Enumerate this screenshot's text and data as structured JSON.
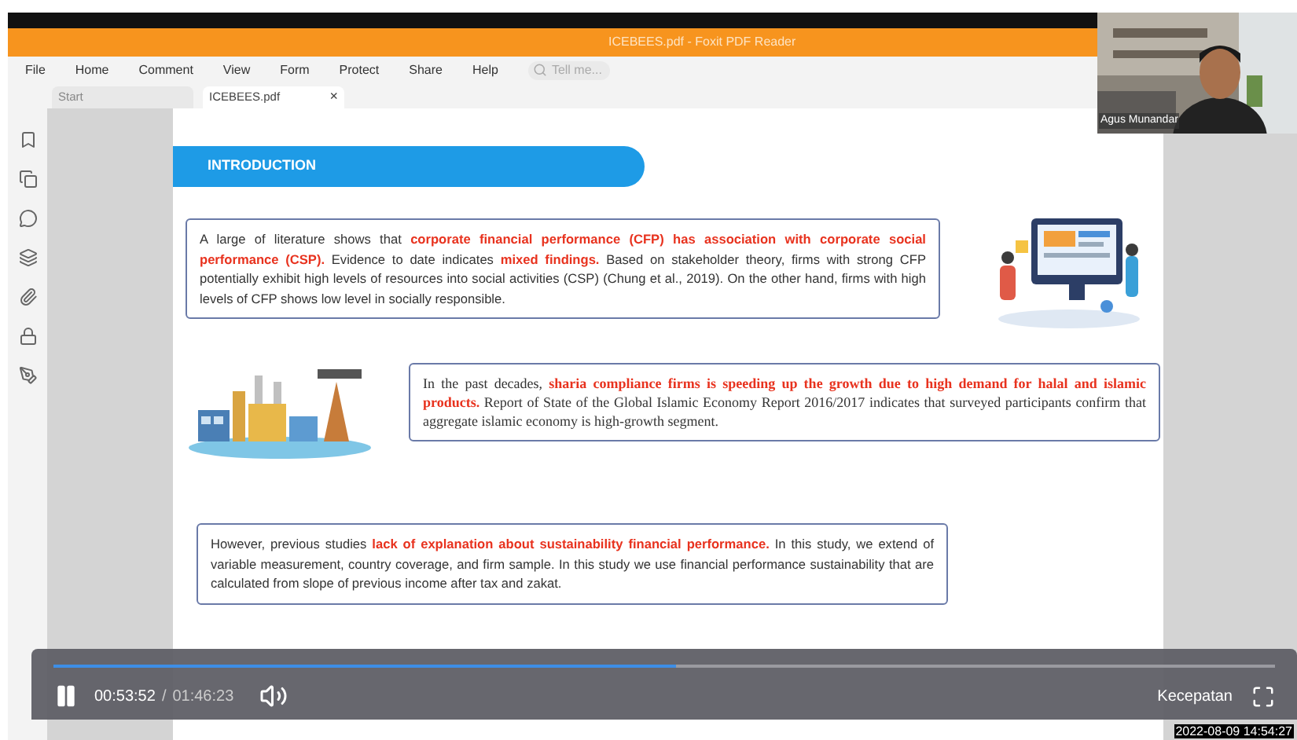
{
  "app": {
    "title": "ICEBEES.pdf - Foxit PDF Reader",
    "menu": [
      "File",
      "Home",
      "Comment",
      "View",
      "Form",
      "Protect",
      "Share",
      "Help"
    ],
    "search": {
      "placeholder": "Tell me..."
    },
    "tabs": [
      {
        "label": "Start",
        "selected": false
      },
      {
        "label": "ICEBEES.pdf",
        "selected": true,
        "close": "×"
      }
    ]
  },
  "document": {
    "heading": "INTRODUCTION",
    "blocks": [
      {
        "kind": "sans",
        "text": "A large of literature shows that **corporate financial performance (CFP) has association with corporate social performance (CSP).** Evidence to date indicates **mixed findings.** Based on stakeholder theory, firms with strong CFP potentially exhibit high levels of resources into social activities (CSP) (Chung et al., 2019). On the other hand, firms with high levels of CFP shows low level in socially responsible."
      },
      {
        "kind": "serif",
        "text": "In the past decades, **sharia compliance firms is speeding up the growth due to high demand for halal and islamic products.** Report of State of the Global Islamic Economy Report 2016/2017 indicates that surveyed participants confirm that aggregate islamic economy is high-growth segment."
      },
      {
        "kind": "sans",
        "text": "However, previous studies **lack of explanation about sustainability financial performance.** In this study, we extend of variable measurement, country coverage, and firm sample. In this study we use financial performance sustainability that are calculated from slope of previous income after tax and zakat."
      }
    ]
  },
  "webcam": {
    "name": "Agus Munandar"
  },
  "player": {
    "playing": true,
    "level": 0.51,
    "current": "00:53:52",
    "separator": "/",
    "duration": "01:46:23",
    "speed": "Kecepatan"
  },
  "timestamp": "2022-08-09 14:54:27"
}
